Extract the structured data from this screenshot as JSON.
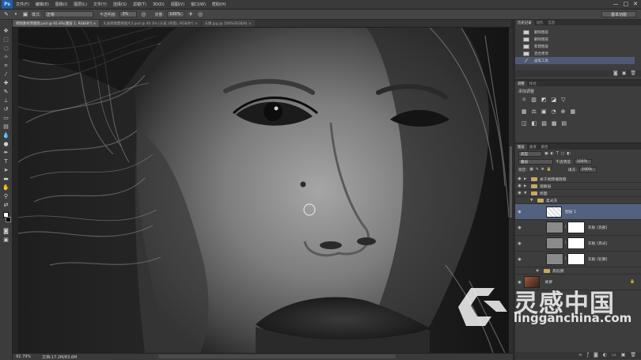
{
  "app": {
    "logo": "Ps",
    "menu": [
      "文件(F)",
      "编辑(E)",
      "图像(I)",
      "图层(L)",
      "文字(Y)",
      "选择(S)",
      "滤镜(T)",
      "3D(D)",
      "视图(V)",
      "窗口(W)",
      "帮助(H)"
    ],
    "window_controls": [
      "—",
      "□",
      "✕"
    ]
  },
  "options_bar": {
    "mode_label": "模式:",
    "mode_value": "正常",
    "opacity_label": "不透明度:",
    "opacity_value": "3%",
    "flow_label": "流量:",
    "flow_value": "100%",
    "workspace": "基本功能"
  },
  "doc_tabs": [
    {
      "label": "修图素材原图图.psd @ 92.8%(图层 1, RGB/8*) ×",
      "active": true
    },
    {
      "label": "头发修图需要图片2.psd @ 40.3% (头发 (背景), RGB/8*) ×",
      "active": false
    },
    {
      "label": "头像.jpg @ 100%(RGB/8) ×",
      "active": false
    }
  ],
  "status": {
    "zoom": "92.79%",
    "doc": "文档:17.2M/83.6M"
  },
  "history": {
    "tabs": [
      "历史记录",
      "动作",
      "信息"
    ],
    "items": [
      {
        "label": "删除图层",
        "selected": false
      },
      {
        "label": "删除图层",
        "selected": false
      },
      {
        "label": "新建图层",
        "selected": false
      },
      {
        "label": "混合更改",
        "selected": false
      },
      {
        "label": "画笔工具",
        "selected": true
      }
    ]
  },
  "adjustments": {
    "tabs": [
      "调整",
      "样式"
    ],
    "title": "添加调整",
    "row1": [
      "☼",
      "▥",
      "◩",
      "◪",
      "▽"
    ],
    "row2": [
      "▦",
      "⚖",
      "▣",
      "◔",
      "⊕",
      "▦"
    ],
    "row3": [
      "◫",
      "◧",
      "▨",
      "▩",
      "▤"
    ]
  },
  "layers": {
    "tabs": [
      "图层",
      "通道",
      "路径"
    ],
    "kind_label": "类型",
    "blend_mode": "叠加",
    "opacity_label": "不透明度:",
    "opacity_value": "100%",
    "lock_label": "锁定:",
    "fill_label": "填充:",
    "fill_value": "100%",
    "items": [
      {
        "name": "关于视频播放链",
        "type": "group",
        "indent": 0,
        "selected": false
      },
      {
        "name": "观察层",
        "type": "group",
        "indent": 0,
        "selected": false
      },
      {
        "name": "修图",
        "type": "group-open",
        "indent": 0,
        "selected": false
      },
      {
        "name": "柔光灰",
        "type": "group-open",
        "indent": 1,
        "selected": false
      },
      {
        "name": "图层 1",
        "type": "layer",
        "indent": 2,
        "selected": true
      },
      {
        "name": "灰板 (亮部)",
        "type": "mask",
        "indent": 2,
        "selected": false
      },
      {
        "name": "灰板 (高光)",
        "type": "mask",
        "indent": 2,
        "selected": false
      },
      {
        "name": "灰板 (轮廓)",
        "type": "mask",
        "indent": 2,
        "selected": false
      },
      {
        "name": "高低频",
        "type": "group",
        "indent": 1,
        "selected": false
      },
      {
        "name": "背景",
        "type": "background",
        "indent": 0,
        "selected": false
      }
    ]
  },
  "watermark": {
    "name": "灵感中国",
    "url": "lingganchina.com"
  }
}
